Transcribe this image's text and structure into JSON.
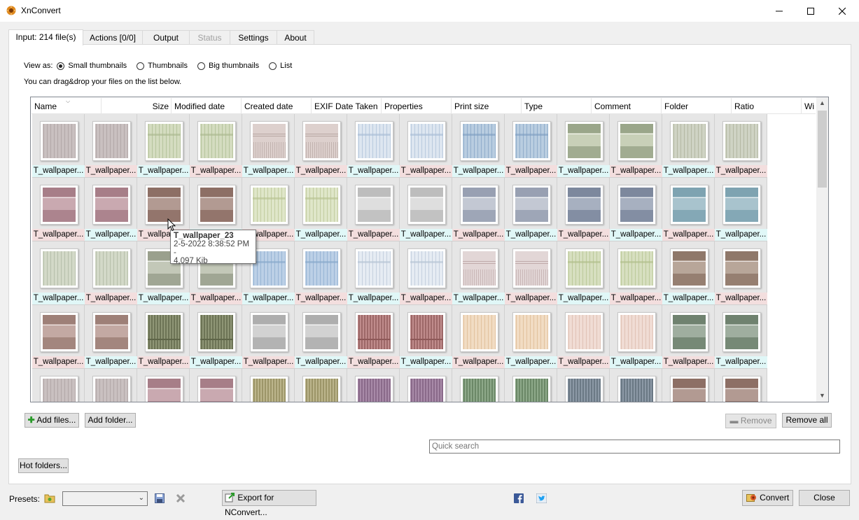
{
  "window": {
    "title": "XnConvert"
  },
  "tabs": [
    {
      "label": "Input: 214 file(s)",
      "state": "active"
    },
    {
      "label": "Actions [0/0]",
      "state": "normal"
    },
    {
      "label": "Output",
      "state": "normal"
    },
    {
      "label": "Status",
      "state": "disabled"
    },
    {
      "label": "Settings",
      "state": "normal"
    },
    {
      "label": "About",
      "state": "normal"
    }
  ],
  "view": {
    "label": "View as:",
    "options": [
      "Small thumbnails",
      "Thumbnails",
      "Big thumbnails",
      "List"
    ],
    "selected": "Small thumbnails",
    "hint": "You can drag&drop your files on the list below."
  },
  "columns": [
    "Name",
    "Size",
    "Modified date",
    "Created date",
    "EXIF Date Taken",
    "Properties",
    "Print size",
    "Type",
    "Comment",
    "Folder",
    "Ratio",
    "Wi"
  ],
  "thumbnails": {
    "caption": "T_wallpaper...",
    "rows": [
      [
        [
          "#c9c0c0",
          "#a89c9c",
          "v"
        ],
        [
          "#c9c0c0",
          "#a89c9c",
          "v"
        ],
        [
          "#d4dcc0",
          "#aab98e",
          "vb"
        ],
        [
          "#d4dcc0",
          "#aab98e",
          "vb"
        ],
        [
          "#ddd0cd",
          "#b7a6a2",
          "h"
        ],
        [
          "#ddd0cd",
          "#b7a6a2",
          "h"
        ],
        [
          "#dde6f0",
          "#a9bdd6",
          "vb"
        ],
        [
          "#dde6f0",
          "#a9bdd6",
          "vb"
        ],
        [
          "#b9cde0",
          "#7f9fc2",
          "vb"
        ],
        [
          "#b9cde0",
          "#7f9fc2",
          "vb"
        ],
        [
          "#c8d0b8",
          "#9aa68a",
          "p"
        ],
        [
          "#c8d0b8",
          "#9aa68a",
          "p"
        ],
        [
          "#cfd3c4",
          "#a7ad96",
          "v"
        ],
        [
          "#cfd3c4",
          "#a7ad96",
          "v"
        ]
      ],
      [
        [
          "#c9a9b0",
          "#a77e88",
          "p"
        ],
        [
          "#c9a9b0",
          "#a77e88",
          "p"
        ],
        [
          "#b29a92",
          "#8d6f65",
          "p"
        ],
        [
          "#b29a92",
          "#8d6f65",
          "p"
        ],
        [
          "#dfe6c9",
          "#b5c18f",
          "vb"
        ],
        [
          "#dfe6c9",
          "#b5c18f",
          "vb"
        ],
        [
          "#dedede",
          "#bdbdbd",
          "p"
        ],
        [
          "#dedede",
          "#bdbdbd",
          "p"
        ],
        [
          "#c3c8d3",
          "#98a0b2",
          "p"
        ],
        [
          "#c3c8d3",
          "#98a0b2",
          "p"
        ],
        [
          "#a7b0c0",
          "#7d889d",
          "p"
        ],
        [
          "#a7b0c0",
          "#7d889d",
          "p"
        ],
        [
          "#a8c3cd",
          "#7ea3b1",
          "p"
        ],
        [
          "#a8c3cd",
          "#7ea3b1",
          "p"
        ]
      ],
      [
        [
          "#d3d9c8",
          "#aab39c",
          "v"
        ],
        [
          "#d3d9c8",
          "#aab39c",
          "v"
        ],
        [
          "#c3c8b8",
          "#9aa08d",
          "p"
        ],
        [
          "#c3c8b8",
          "#9aa08d",
          "p"
        ],
        [
          "#bcd0e6",
          "#87a8cc",
          "vb"
        ],
        [
          "#bcd0e6",
          "#87a8cc",
          "vb"
        ],
        [
          "#e6ecf3",
          "#b6c4d6",
          "vb"
        ],
        [
          "#e6ecf3",
          "#b6c4d6",
          "vb"
        ],
        [
          "#e2d6d6",
          "#bfaaaa",
          "h"
        ],
        [
          "#e2d6d6",
          "#bfaaaa",
          "h"
        ],
        [
          "#d7dfc0",
          "#b1c08a",
          "vb"
        ],
        [
          "#d7dfc0",
          "#b1c08a",
          "vb"
        ],
        [
          "#b8a699",
          "#8f786a",
          "p"
        ],
        [
          "#b8a699",
          "#8f786a",
          "p"
        ]
      ],
      [
        [
          "#c3a9a3",
          "#9e8078",
          "p"
        ],
        [
          "#c3a9a3",
          "#9e8078",
          "p"
        ],
        [
          "#8f9676",
          "#5e6548",
          "vd"
        ],
        [
          "#8f9676",
          "#5e6548",
          "vd"
        ],
        [
          "#d2d2d2",
          "#aeaeae",
          "p"
        ],
        [
          "#d2d2d2",
          "#aeaeae",
          "p"
        ],
        [
          "#c08c8c",
          "#8e5858",
          "vd"
        ],
        [
          "#c08c8c",
          "#8e5858",
          "vd"
        ],
        [
          "#f1dcc3",
          "#dcb58d",
          "v"
        ],
        [
          "#f1dcc3",
          "#dcb58d",
          "v"
        ],
        [
          "#f0dcd4",
          "#d9b6a8",
          "v"
        ],
        [
          "#f0dcd4",
          "#d9b6a8",
          "v"
        ],
        [
          "#9fae9f",
          "#6f826f",
          "p"
        ],
        [
          "#9fae9f",
          "#6f826f",
          "p"
        ]
      ],
      [
        [
          "#c9c0c0",
          "#a89c9c",
          "v"
        ],
        [
          "#c9c0c0",
          "#a89c9c",
          "v"
        ],
        [
          "#c9a9b0",
          "#a77e88",
          "p"
        ],
        [
          "#c9a9b0",
          "#a77e88",
          "p"
        ],
        [
          "#bcb58c",
          "#8e8758",
          "vd"
        ],
        [
          "#bcb58c",
          "#8e8758",
          "vd"
        ],
        [
          "#a88aa8",
          "#7e5d7e",
          "vd"
        ],
        [
          "#a88aa8",
          "#7e5d7e",
          "vd"
        ],
        [
          "#8ea98a",
          "#5d7a59",
          "vd"
        ],
        [
          "#8ea98a",
          "#5d7a59",
          "vd"
        ],
        [
          "#8c99a6",
          "#5d6b78",
          "vd"
        ],
        [
          "#8c99a6",
          "#5d6b78",
          "vd"
        ],
        [
          "#b29a92",
          "#8d6f65",
          "p"
        ],
        [
          "#b29a92",
          "#8d6f65",
          "p"
        ]
      ]
    ]
  },
  "tooltip": {
    "name": "T_wallpaper_23",
    "date": "2-5-2022 8:38:52 PM -",
    "size": "4,097 Kib"
  },
  "buttons": {
    "add_files": "Add files...",
    "add_folder": "Add folder...",
    "remove": "Remove",
    "remove_all": "Remove all",
    "hot_folders": "Hot folders...",
    "export": "Export for NConvert...",
    "convert": "Convert",
    "close": "Close"
  },
  "search": {
    "placeholder": "Quick search"
  },
  "presets": {
    "label": "Presets:",
    "value": ""
  },
  "colors": {
    "accent": "#0078d7",
    "caption_cyan": "#e0f7f7",
    "caption_pink": "#f3dede"
  }
}
